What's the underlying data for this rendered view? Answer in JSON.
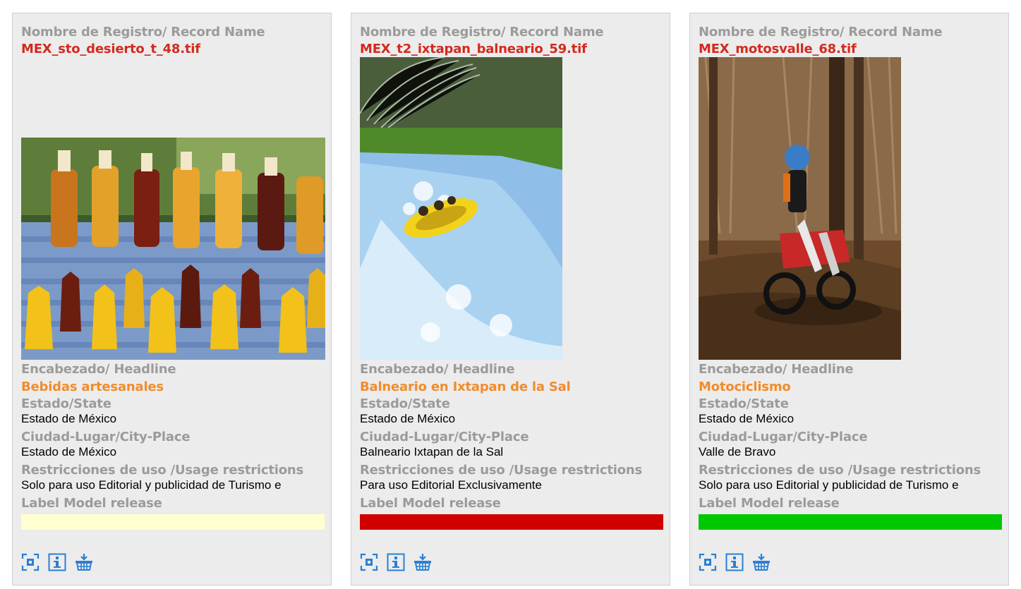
{
  "records": [
    {
      "record_name_label": "Nombre de Registro/ Record Name",
      "record_name": "MEX_sto_desierto_t_48.tif",
      "headline_label": "Encabezado/ Headline",
      "headline": "Bebidas artesanales",
      "state_label": "Estado/State",
      "state": "Estado de México",
      "city_label": "Ciudad-Lugar/City-Place",
      "city": "Estado de México",
      "usage_label": "Restricciones de uso /Usage restrictions",
      "usage": "Solo para uso Editorial y publicidad de Turismo e",
      "release_label": "Label Model release",
      "release_color": "#ffffd0"
    },
    {
      "record_name_label": "Nombre de Registro/ Record Name",
      "record_name": "MEX_t2_ixtapan_balneario_59.tif",
      "headline_label": "Encabezado/ Headline",
      "headline": "Balneario en Ixtapan de la Sal",
      "state_label": "Estado/State",
      "state": "Estado de México",
      "city_label": "Ciudad-Lugar/City-Place",
      "city": "Balneario Ixtapan de la Sal",
      "usage_label": "Restricciones de uso /Usage restrictions",
      "usage": "Para uso Editorial Exclusivamente",
      "release_label": "Label Model release",
      "release_color": "#d00000"
    },
    {
      "record_name_label": "Nombre de Registro/ Record Name",
      "record_name": "MEX_motosvalle_68.tif",
      "headline_label": "Encabezado/ Headline",
      "headline": "Motociclismo",
      "state_label": "Estado/State",
      "state": "Estado de México",
      "city_label": "Ciudad-Lugar/City-Place",
      "city": "Valle de Bravo",
      "usage_label": "Restricciones de uso /Usage restrictions",
      "usage": "Solo para uso Editorial y publicidad de Turismo e",
      "release_label": "Label Model release",
      "release_color": "#00c800"
    }
  ],
  "icons": [
    "zoom-icon",
    "info-icon",
    "basket-icon"
  ],
  "colors": {
    "label": "#9b9b9b",
    "record_name": "#d32a1e",
    "headline": "#f28c2a",
    "icon": "#2a7fd4"
  }
}
